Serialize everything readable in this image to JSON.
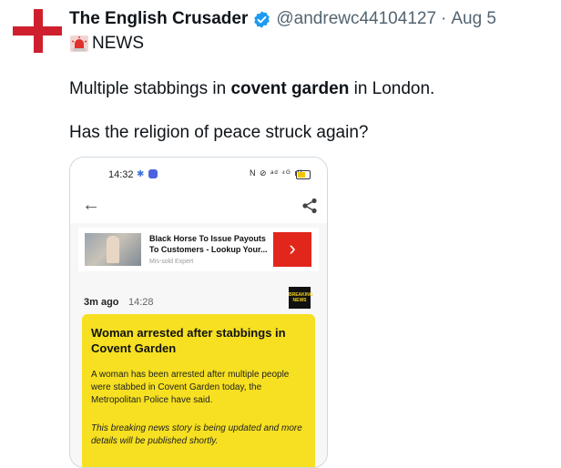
{
  "tweet": {
    "author_name": "The English Crusader",
    "handle": "@andrewc44104127",
    "separator": "·",
    "date": "Aug 5",
    "news_label": "NEWS",
    "line1_pre": "Multiple stabbings in ",
    "line1_bold": "covent garden",
    "line1_post": " in London.",
    "line2": "Has the religion of peace struck again?"
  },
  "screenshot": {
    "status_time": "14:32",
    "status_right": "N ⊘ ᵃᵈ ⁴ᴳ ıll",
    "ad": {
      "title": "Black Horse To Issue Payouts To Customers - Lookup Your...",
      "source": "Mis-sold Expert",
      "button_glyph": "›"
    },
    "article": {
      "ago": "3m ago",
      "time": "14:28",
      "logo_text": "BREAKING NEWS",
      "headline": "Woman arrested after stabbings in Covent Garden",
      "body": "A woman has been arrested after multiple people were stabbed in Covent Garden today, the Metropolitan Police have said.",
      "note": "This breaking news story is being updated and more details will be published shortly."
    }
  },
  "colors": {
    "cross_red": "#cf1f2e",
    "verified_blue": "#1d9bf0",
    "card_yellow": "#f6e021",
    "ad_red": "#e1261c"
  },
  "icons": {
    "avatar": "red-cross",
    "verified": "verified-badge-icon",
    "siren": "police-light-icon",
    "back": "back-arrow-icon",
    "share": "share-icon"
  }
}
